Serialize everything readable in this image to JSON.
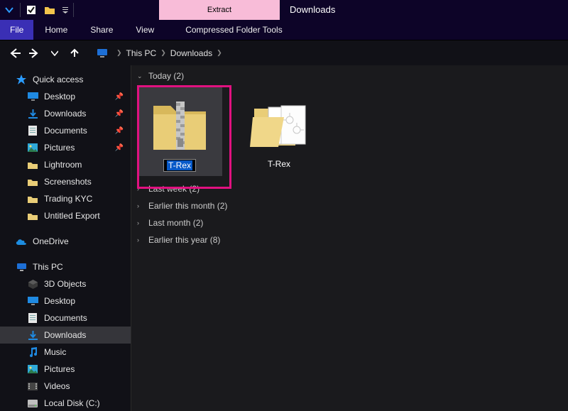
{
  "title_qat": {
    "save_checked": true
  },
  "ribbon": {
    "extract_group": "Extract",
    "cft_caption": "Compressed Folder Tools",
    "window_title": "Downloads"
  },
  "menu": {
    "file": "File",
    "home": "Home",
    "share": "Share",
    "view": "View"
  },
  "nav": {
    "crumb_root": "This PC",
    "crumb_folder": "Downloads"
  },
  "sidebar": {
    "quick_access": "Quick access",
    "qa_items": [
      {
        "label": "Desktop",
        "icon": "desktop",
        "pin": true
      },
      {
        "label": "Downloads",
        "icon": "download",
        "pin": true
      },
      {
        "label": "Documents",
        "icon": "doc",
        "pin": true
      },
      {
        "label": "Pictures",
        "icon": "pics",
        "pin": true
      },
      {
        "label": "Lightroom",
        "icon": "folder",
        "pin": false
      },
      {
        "label": "Screenshots",
        "icon": "folder",
        "pin": false
      },
      {
        "label": "Trading KYC",
        "icon": "folder",
        "pin": false
      },
      {
        "label": "Untitled Export",
        "icon": "folder",
        "pin": false
      }
    ],
    "onedrive": "OneDrive",
    "this_pc": "This PC",
    "pc_items": [
      {
        "label": "3D Objects",
        "icon": "3d"
      },
      {
        "label": "Desktop",
        "icon": "desktop"
      },
      {
        "label": "Documents",
        "icon": "doc"
      },
      {
        "label": "Downloads",
        "icon": "download",
        "selected": true
      },
      {
        "label": "Music",
        "icon": "music"
      },
      {
        "label": "Pictures",
        "icon": "pics"
      },
      {
        "label": "Videos",
        "icon": "video"
      },
      {
        "label": "Local Disk (C:)",
        "icon": "disk"
      }
    ]
  },
  "content": {
    "groups": [
      {
        "title": "Today",
        "count": 2,
        "expanded": true
      },
      {
        "title": "Last week",
        "count": 2,
        "expanded": false
      },
      {
        "title": "Earlier this month",
        "count": 2,
        "expanded": false
      },
      {
        "title": "Last month",
        "count": 2,
        "expanded": false
      },
      {
        "title": "Earlier this year",
        "count": 8,
        "expanded": false
      }
    ],
    "today_items": [
      {
        "name": "T-Rex",
        "type": "zip",
        "selected": true,
        "editing": true
      },
      {
        "name": "T-Rex",
        "type": "folder",
        "selected": false,
        "editing": false
      }
    ]
  }
}
